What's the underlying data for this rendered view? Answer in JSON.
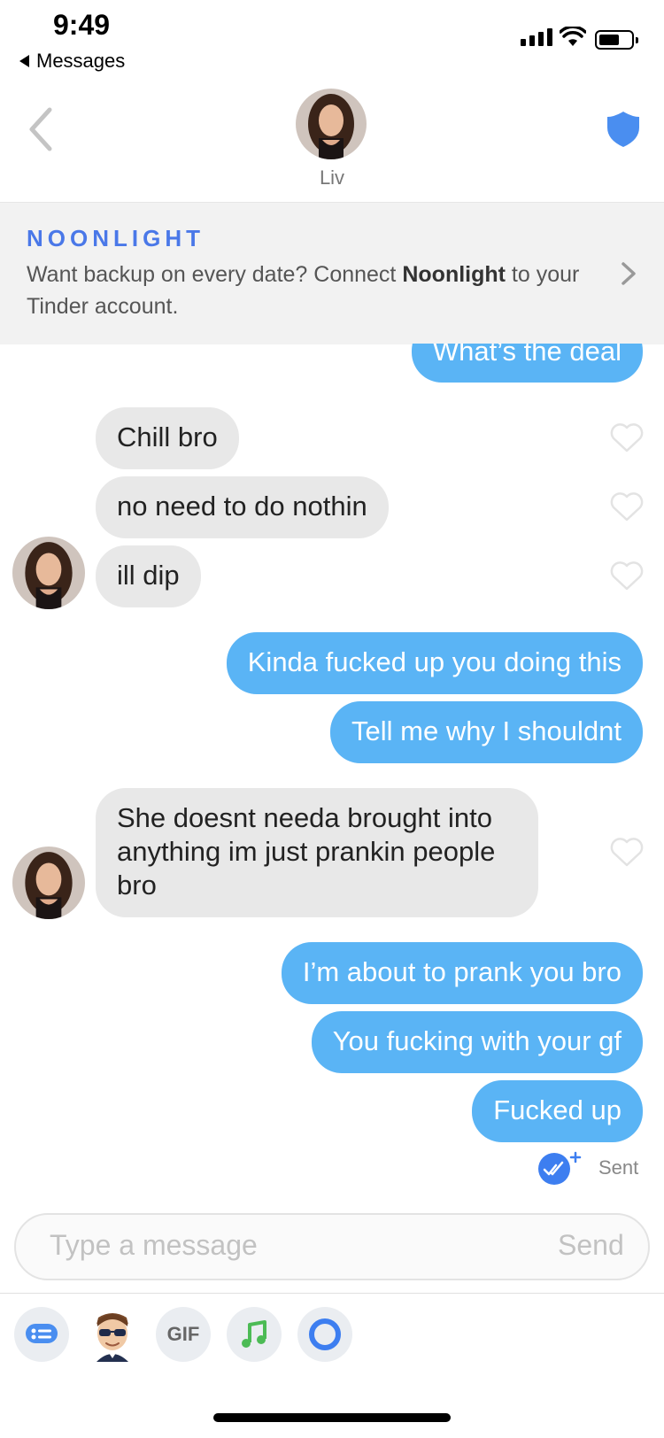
{
  "status_bar": {
    "time": "9:49",
    "back_label": "Messages"
  },
  "header": {
    "match_name": "Liv",
    "shield_color": "#4a8ef0"
  },
  "banner": {
    "brand": "NOONLIGHT",
    "text_before": "Want backup on every date? Connect ",
    "text_bold": "Noonlight",
    "text_after": " to your Tinder account."
  },
  "messages": [
    {
      "direction": "out",
      "text": "What’s the deal"
    },
    {
      "direction": "in",
      "text": "Chill bro"
    },
    {
      "direction": "in",
      "text": "no need to do nothin"
    },
    {
      "direction": "in",
      "text": "ill dip"
    },
    {
      "direction": "out",
      "text": "Kinda fucked up you doing this"
    },
    {
      "direction": "out",
      "text": "Tell me why I shouldnt"
    },
    {
      "direction": "in",
      "text_lines": [
        "She doesnt needa brought into",
        "anything im just prankin people",
        "bro"
      ]
    },
    {
      "direction": "out",
      "text": "I’m about to prank you bro"
    },
    {
      "direction": "out",
      "text": "You fucking with your gf"
    },
    {
      "direction": "out",
      "text": "Fucked up"
    }
  ],
  "receipt": {
    "label": "Sent"
  },
  "composer": {
    "placeholder": "Type a message",
    "send_label": "Send"
  },
  "toolbar": {
    "gif_label": "GIF"
  },
  "colors": {
    "outgoing_bubble": "#5ab4f5",
    "incoming_bubble": "#e8e8e8",
    "brand_blue": "#4a78e8"
  }
}
